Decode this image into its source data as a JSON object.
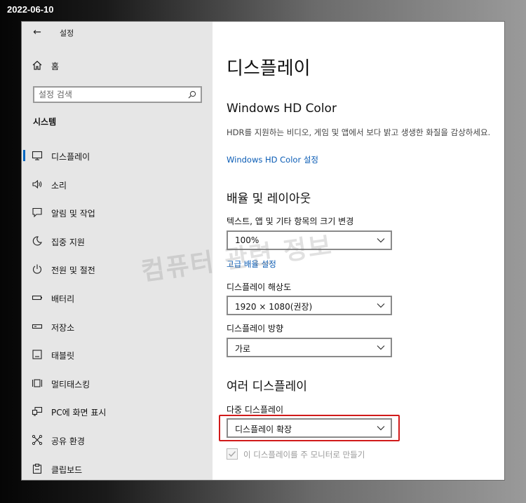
{
  "date_stamp": "2022-06-10",
  "titlebar": {
    "title": "설정"
  },
  "sidebar": {
    "home_label": "홈",
    "search_placeholder": "설정 검색",
    "section_label": "시스템",
    "items": [
      {
        "label": "디스플레이",
        "icon": "monitor-icon",
        "active": true
      },
      {
        "label": "소리",
        "icon": "speaker-icon"
      },
      {
        "label": "알림 및 작업",
        "icon": "notification-icon"
      },
      {
        "label": "집중 지원",
        "icon": "moon-icon"
      },
      {
        "label": "전원 및 절전",
        "icon": "power-icon"
      },
      {
        "label": "배터리",
        "icon": "battery-icon"
      },
      {
        "label": "저장소",
        "icon": "storage-icon"
      },
      {
        "label": "태블릿",
        "icon": "tablet-icon"
      },
      {
        "label": "멀티태스킹",
        "icon": "multitasking-icon"
      },
      {
        "label": "PC에 화면 표시",
        "icon": "project-icon"
      },
      {
        "label": "공유 환경",
        "icon": "shared-experiences-icon"
      },
      {
        "label": "클립보드",
        "icon": "clipboard-icon"
      }
    ]
  },
  "content": {
    "page_title": "디스플레이",
    "hdr": {
      "heading": "Windows HD Color",
      "description": "HDR를 지원하는 비디오, 게임 및 앱에서 보다 밝고 생생한 화질을 감상하세요.",
      "link": "Windows HD Color 설정"
    },
    "scale_layout": {
      "heading": "배율 및 레이아웃",
      "scale_label": "텍스트, 앱 및 기타 항목의 크기 변경",
      "scale_value": "100%",
      "advanced_link": "고급 배율 설정",
      "resolution_label": "디스플레이 해상도",
      "resolution_value": "1920 × 1080(권장)",
      "orientation_label": "디스플레이 방향",
      "orientation_value": "가로"
    },
    "multi_display": {
      "heading": "여러 디스플레이",
      "multi_label": "다중 디스플레이",
      "multi_value": "디스플레이 확장",
      "main_display_checkbox": "이 디스플레이를 주 모니터로 만들기",
      "main_display_checked": true
    }
  },
  "watermark": "컴퓨터 관련 정보",
  "colors": {
    "accent": "#0067c0",
    "link": "#0a5cb5",
    "highlight": "#d11a1a",
    "sidebar_bg": "#e6e6e6"
  }
}
